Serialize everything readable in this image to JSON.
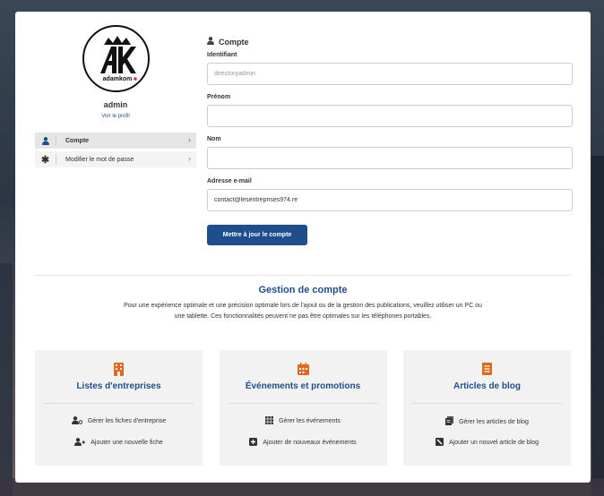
{
  "profile": {
    "logo_text": "adamkom",
    "name": "admin",
    "view_profile": "Voir le profil"
  },
  "menu": [
    {
      "label": "Compte",
      "icon": "user-icon"
    },
    {
      "label": "Modifier le mot de passe",
      "icon": "asterisk-icon"
    }
  ],
  "form": {
    "title": "Compte",
    "username_label": "Identifiant",
    "username_value": "directoryadmin",
    "firstname_label": "Prénom",
    "firstname_value": "",
    "lastname_label": "Nom",
    "lastname_value": "",
    "email_label": "Adresse e-mail",
    "email_value": "contact@lesentreprises974.re",
    "submit_label": "Mettre à jour le compte"
  },
  "management": {
    "title": "Gestion de compte",
    "description": "Pour une expérience optimale et une précision optimale lors de l'ajout ou de la gestion des publications, veuillez utiliser un PC ou une tablette. Ces fonctionnalités peuvent ne pas être optimales sur les téléphones portables."
  },
  "tiles": [
    {
      "title": "Listes d'entreprises",
      "icon": "building-icon",
      "links": [
        {
          "label": "Gérer les fiches d'entreprise",
          "icon": "users-cog-icon"
        },
        {
          "label": "Ajouter une nouvelle fiche",
          "icon": "user-plus-icon"
        }
      ]
    },
    {
      "title": "Événements et promotions",
      "icon": "calendar-icon",
      "links": [
        {
          "label": "Gérer les événements",
          "icon": "grid-icon"
        },
        {
          "label": "Ajouter de nouveaux événements",
          "icon": "plus-square-icon"
        }
      ]
    },
    {
      "title": "Articles de blog",
      "icon": "document-icon",
      "links": [
        {
          "label": "Gérer les articles de blog",
          "icon": "files-icon"
        },
        {
          "label": "Ajouter un nouvel article de blog",
          "icon": "edit-square-icon"
        }
      ]
    }
  ],
  "colors": {
    "primary": "#1f4e8c",
    "accent": "#e06a1b"
  }
}
